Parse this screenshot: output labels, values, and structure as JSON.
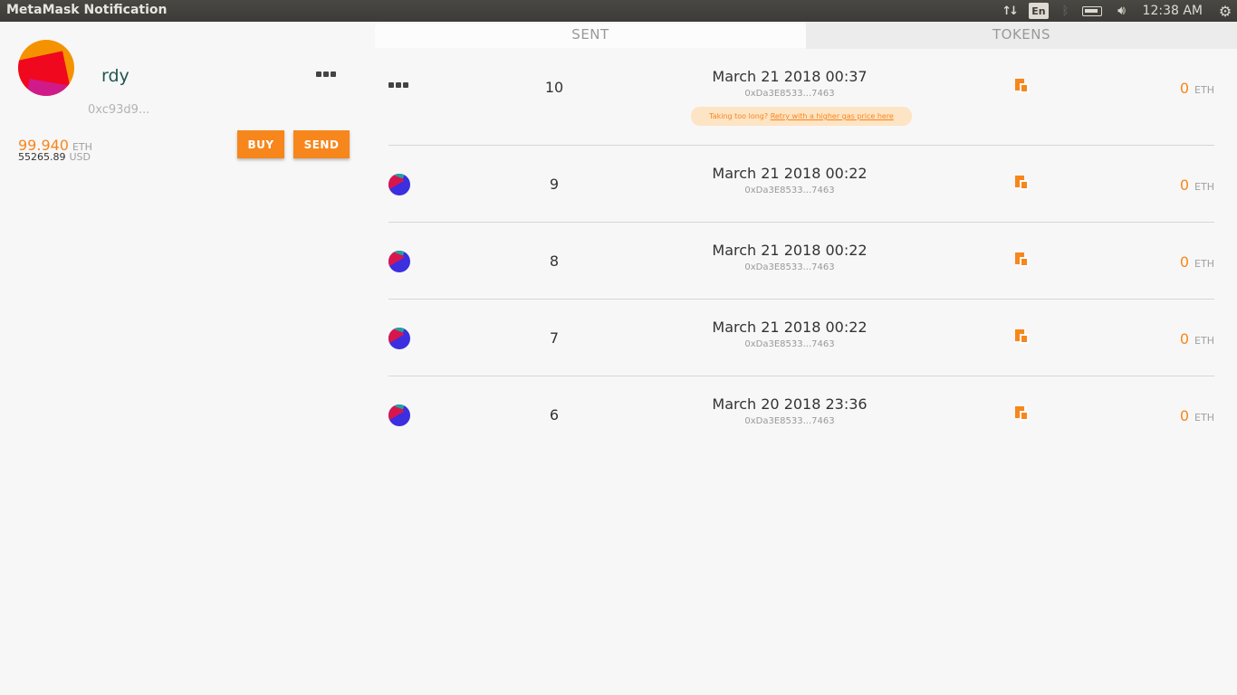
{
  "system": {
    "window_title": "MetaMask Notification",
    "tray": {
      "network_icon": "network-arrows-icon",
      "language": "En",
      "bluetooth_icon": "bluetooth-icon",
      "battery_icon": "battery-icon",
      "volume_icon": "volume-icon",
      "clock": "12:38 AM",
      "settings_icon": "power-gear-icon"
    }
  },
  "account": {
    "name": "rdy",
    "address": "0xc93d9...",
    "balance_eth": "99.940",
    "eth_unit": "ETH",
    "balance_usd": "55265.89",
    "usd_unit": "USD",
    "buy_label": "BUY",
    "send_label": "SEND",
    "menu_icon": "more-options-icon"
  },
  "tabs": {
    "sent": "SENT",
    "tokens": "TOKENS",
    "active": "sent"
  },
  "transactions": [
    {
      "nonce": "10",
      "date": "March 21 2018 00:37",
      "to": "0xDa3E8533...7463",
      "value": "0",
      "unit": "ETH",
      "pending": true,
      "retry_prefix": "Taking too long? ",
      "retry_link": "Retry with a higher gas price here"
    },
    {
      "nonce": "9",
      "date": "March 21 2018 00:22",
      "to": "0xDa3E8533...7463",
      "value": "0",
      "unit": "ETH"
    },
    {
      "nonce": "8",
      "date": "March 21 2018 00:22",
      "to": "0xDa3E8533...7463",
      "value": "0",
      "unit": "ETH"
    },
    {
      "nonce": "7",
      "date": "March 21 2018 00:22",
      "to": "0xDa3E8533...7463",
      "value": "0",
      "unit": "ETH"
    },
    {
      "nonce": "6",
      "date": "March 20 2018 23:36",
      "to": "0xDa3E8533...7463",
      "value": "0",
      "unit": "ETH"
    }
  ],
  "colors": {
    "accent": "#f7861c",
    "account_name": "#215651",
    "background": "#f7f7f7"
  }
}
